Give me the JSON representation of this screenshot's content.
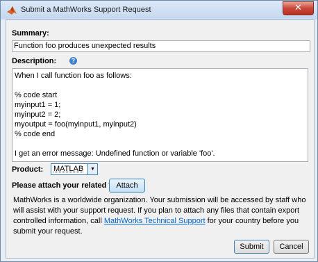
{
  "window": {
    "title": "Submit a MathWorks Support Request",
    "close_glyph": "✕"
  },
  "summary": {
    "label": "Summary:",
    "value": "Function foo produces unexpected results"
  },
  "description": {
    "label": "Description:",
    "help_glyph": "?",
    "text": "When I call function foo as follows:\n\n% code start\nmyinput1 = 1;\nmyinput2 = 2;\nmyoutput = foo(myinput1, myinput2)\n% code end\n\nI get an error message: Undefined function or variable 'foo'."
  },
  "product": {
    "label": "Product:",
    "selected": "MATLAB"
  },
  "attach": {
    "label": "Please attach your related files:",
    "button": "Attach"
  },
  "info": {
    "text_before": "MathWorks is a worldwide organization. Your submission will be accessed by staff who will assist with your support request. If you plan to attach any files that contain export controlled information, call ",
    "link": "MathWorks Technical Support",
    "text_after": " for your country before you submit your request."
  },
  "buttons": {
    "submit": "Submit",
    "cancel": "Cancel"
  },
  "colors": {
    "link": "#0066cc",
    "close_button": "#c9463a",
    "focus_border": "#3c7fb1"
  },
  "icons": {
    "title": "matlab-logo-icon",
    "help": "help-icon",
    "dropdown": "chevron-down-icon",
    "close": "close-icon"
  }
}
